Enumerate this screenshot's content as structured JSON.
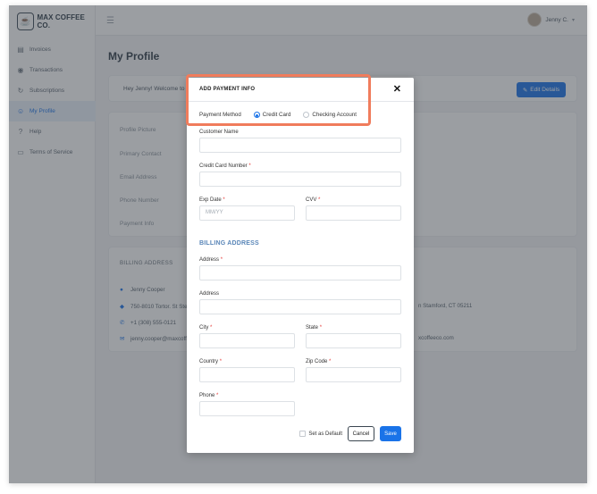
{
  "brand": {
    "name": "MAX COFFEE CO."
  },
  "sidebar": {
    "items": [
      {
        "label": "Invoices",
        "icon": "invoice-icon"
      },
      {
        "label": "Transactions",
        "icon": "transactions-icon"
      },
      {
        "label": "Subscriptions",
        "icon": "refresh-icon"
      },
      {
        "label": "My Profile",
        "icon": "user-icon",
        "active": true
      },
      {
        "label": "Help",
        "icon": "help-icon"
      },
      {
        "label": "Terms of Service",
        "icon": "document-icon"
      }
    ]
  },
  "topbar": {
    "user_name": "Jenny C."
  },
  "page": {
    "title": "My Profile",
    "welcome": "Hey Jenny! Welcome to y",
    "edit_button": "Edit Details",
    "profile_labels": [
      "Profile Picture",
      "Primary Contact",
      "Email Address",
      "Phone Number",
      "Payment Info"
    ],
    "billing": {
      "title": "BILLING ADDRESS",
      "name": "Jenny Cooper",
      "address": "750-8010 Tortor. St Ste",
      "phone": "+1 (308) 555-0121",
      "email": "jenny.cooper@maxcoff",
      "address_right": "n Stamford, CT 05211",
      "email_right": "xcoffeeco.com"
    }
  },
  "modal": {
    "title": "ADD PAYMENT INFO",
    "close": "✕",
    "payment_method_label": "Payment Method",
    "options": [
      "Credit Card",
      "Checking Account"
    ],
    "selected_option": "Credit Card",
    "customer_name_label": "Customer Name",
    "card_number_label": "Credit Card Number",
    "exp_label": "Exp Date",
    "exp_placeholder": "MM/YY",
    "cvv_label": "CVV",
    "billing_section": "BILLING ADDRESS",
    "address1_label": "Address",
    "address2_label": "Address",
    "city_label": "City",
    "state_label": "State",
    "country_label": "Country",
    "zip_label": "Zip Code",
    "phone_label": "Phone",
    "required_mark": "*",
    "set_default_label": "Set as Default",
    "cancel_label": "Cancel",
    "save_label": "Save"
  },
  "colors": {
    "accent": "#1a73e8",
    "highlight": "#f07c5c",
    "required": "#e53935"
  }
}
